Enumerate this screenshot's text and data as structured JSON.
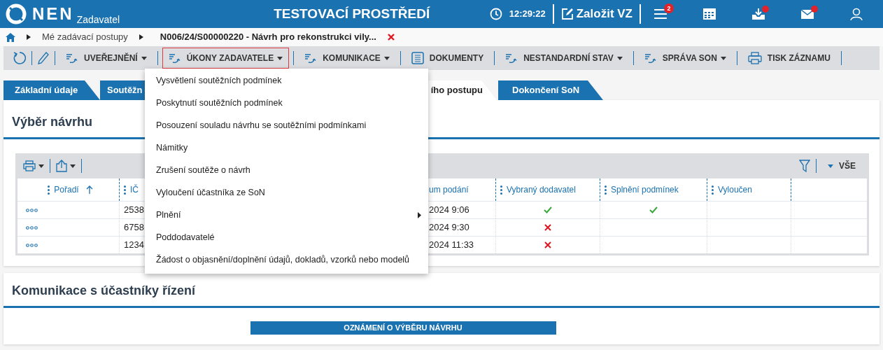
{
  "header": {
    "logo": "NEN",
    "subtitle": "Zadavatel",
    "environment": "TESTOVACÍ PROSTŘEDÍ",
    "time": "12:29:22",
    "create_button": "Založit VZ",
    "icons": [
      {
        "kind": "menu",
        "badge": "2"
      },
      {
        "kind": "calendar"
      },
      {
        "kind": "inbox",
        "notification": true
      },
      {
        "kind": "mail",
        "notification": true
      },
      {
        "kind": "user"
      }
    ]
  },
  "breadcrumb": {
    "items": [
      "Mé zadávací postupy",
      "N006/24/S00000220 - Návrh pro rekonstrukci vily..."
    ]
  },
  "toolbar": [
    {
      "kind": "refresh"
    },
    {
      "kind": "edit"
    },
    {
      "kind": "menu",
      "label": "UVEŘEJNĚNÍ",
      "expanded": false
    },
    {
      "kind": "menu",
      "label": "ÚKONY ZADAVATELE",
      "expanded": true
    },
    {
      "kind": "menu",
      "label": "KOMUNIKACE",
      "expanded": false
    },
    {
      "kind": "document",
      "label": "DOKUMENTY"
    },
    {
      "kind": "menu",
      "label": "NESTANDARDNÍ STAV",
      "expanded": false
    },
    {
      "kind": "menu",
      "label": "SPRÁVA SON",
      "expanded": false
    },
    {
      "kind": "print",
      "label": "TISK ZÁZNAMU"
    }
  ],
  "dropdown": [
    {
      "label": "Vysvětlení soutěžních podmínek",
      "submenu": false
    },
    {
      "label": "Poskytnutí soutěžních podmínek",
      "submenu": false
    },
    {
      "label": "Posouzení souladu návrhu se soutěžními podmínkami",
      "submenu": false
    },
    {
      "label": "Námitky",
      "submenu": false
    },
    {
      "label": "Zrušení soutěže o návrh",
      "submenu": false
    },
    {
      "label": "Vyloučení účastníka ze SoN",
      "submenu": false
    },
    {
      "label": "Plnění",
      "submenu": true
    },
    {
      "label": "Poddodavatelé",
      "submenu": false
    },
    {
      "label": "Žádost o objasnění/doplnění údajů, dokladů, vzorků nebo modelů",
      "submenu": false
    }
  ],
  "tabs": [
    {
      "label": "Základní údaje",
      "selected": false
    },
    {
      "label": "Soutěžn",
      "selected": false
    },
    {
      "label": "ího postupu",
      "selected": true
    },
    {
      "label": "Dokončení SoN",
      "selected": false
    }
  ],
  "selection_panel": {
    "title": "Výběr návrhu",
    "filter_label": "VŠE",
    "columns": [
      {
        "label": "Pořadí",
        "handle": true,
        "sort_ascending": true
      },
      {
        "label": "IČ",
        "handle": true
      },
      {
        "label": "um podání",
        "handle": false
      },
      {
        "label": "Vybraný dodavatel",
        "handle": true
      },
      {
        "label": "Splnění podmínek",
        "handle": true
      },
      {
        "label": "Vyloučen",
        "handle": true
      }
    ],
    "rows": [
      {
        "ico": "2538",
        "date": "2024 9:06",
        "selected_supplier": true,
        "conditions_met": true
      },
      {
        "ico": "6758",
        "date": "2024 9:30",
        "selected_supplier": false
      },
      {
        "ico": "1234",
        "date": "2024 11:33",
        "selected_supplier": false
      }
    ]
  },
  "communication_panel": {
    "title": "Komunikace s účastníky řízení",
    "button": "OZNÁMENÍ O VÝBĚRU NÁVRHU"
  }
}
